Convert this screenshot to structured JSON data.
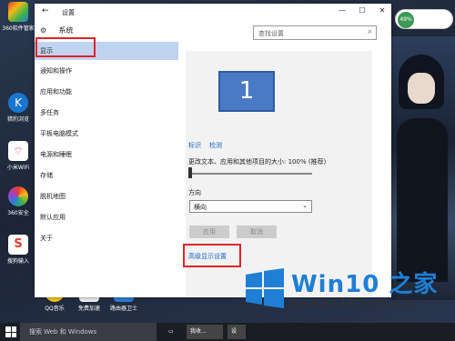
{
  "desktop": {
    "icons": [
      {
        "label": "360软件管家"
      },
      {
        "label": "猎豹浏览"
      },
      {
        "label": "小米WiFi"
      },
      {
        "label": "360安全"
      },
      {
        "label": "搜狗输入"
      },
      {
        "label": "QQ音乐"
      },
      {
        "label": "免费加速"
      },
      {
        "label": "路由器卫士"
      }
    ],
    "perf": "49%"
  },
  "window": {
    "title": "设置",
    "section": "系统",
    "search_placeholder": "查找设置",
    "nav": [
      {
        "label": "显示"
      },
      {
        "label": "通知和操作"
      },
      {
        "label": "应用和功能"
      },
      {
        "label": "多任务"
      },
      {
        "label": "平板电脑模式"
      },
      {
        "label": "电源和睡眠"
      },
      {
        "label": "存储"
      },
      {
        "label": "脱机地图"
      },
      {
        "label": "默认应用"
      },
      {
        "label": "关于"
      }
    ],
    "display": {
      "monitor_number": "1",
      "identify": "标识",
      "detect": "检测",
      "scale_label": "更改文本、应用和其他项目的大小: 100% (推荐)",
      "scale_fraction": 0.0,
      "orientation_label": "方向",
      "orientation_value": "横向",
      "apply": "应用",
      "cancel": "取消",
      "advanced": "高级显示设置"
    }
  },
  "brand": {
    "name": "Win10 之家",
    "url": "www.win10xitong.com"
  },
  "taskbar": {
    "search": "搜索 Web 和 Windows",
    "app1": "我收...",
    "app2": "设"
  },
  "colors": {
    "accent": "#1766c1",
    "highlight": "#c0d3ef",
    "redbox": "#e0232a",
    "monitor": "#4a7ac4"
  }
}
